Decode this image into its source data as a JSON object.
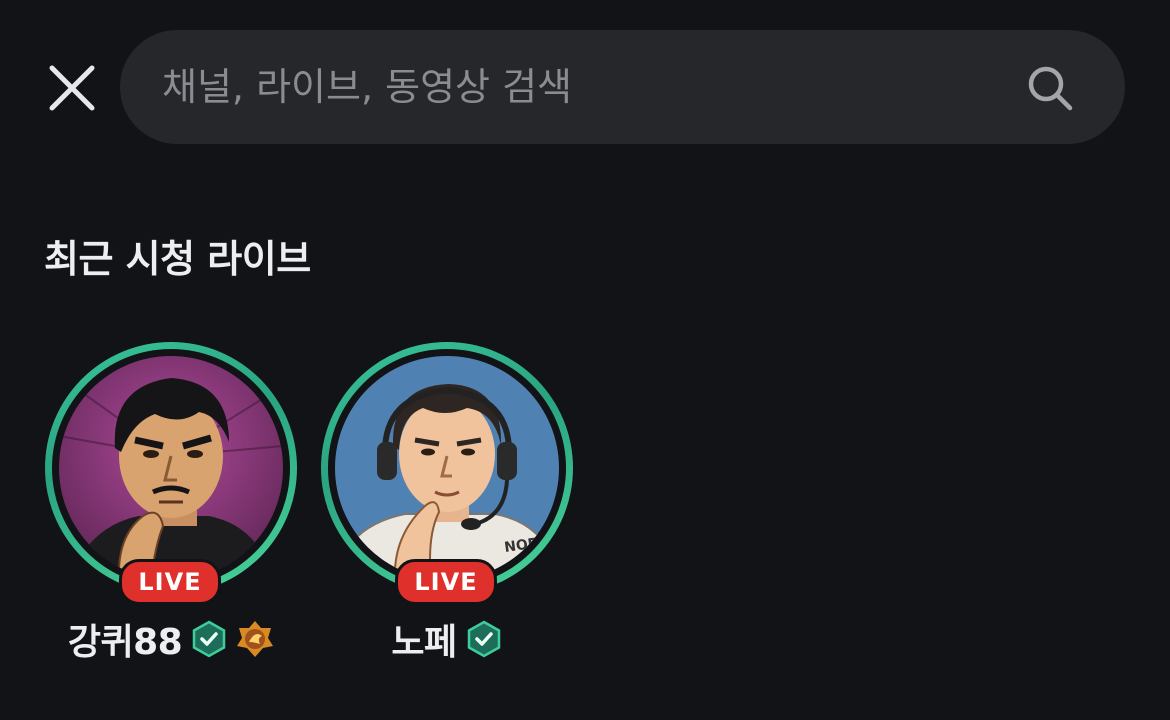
{
  "search": {
    "placeholder": "채널, 라이브, 동영상 검색",
    "value": ""
  },
  "icons": {
    "close": "close-icon",
    "search": "search-icon",
    "verified": "verified-badge-icon",
    "dragon": "dragon-emblem-icon"
  },
  "section": {
    "title": "최근 시청 라이브"
  },
  "channels": [
    {
      "name": "강퀴88",
      "live_label": "LIVE",
      "verified": true,
      "extra_badge": "dragon-emblem-icon"
    },
    {
      "name": "노페",
      "live_label": "LIVE",
      "verified": true
    }
  ],
  "colors": {
    "background": "#121316",
    "search_bg": "#25272b",
    "live_red": "#e0302b",
    "ring_green": "#39c59a",
    "verified_green": "#2fb487"
  }
}
